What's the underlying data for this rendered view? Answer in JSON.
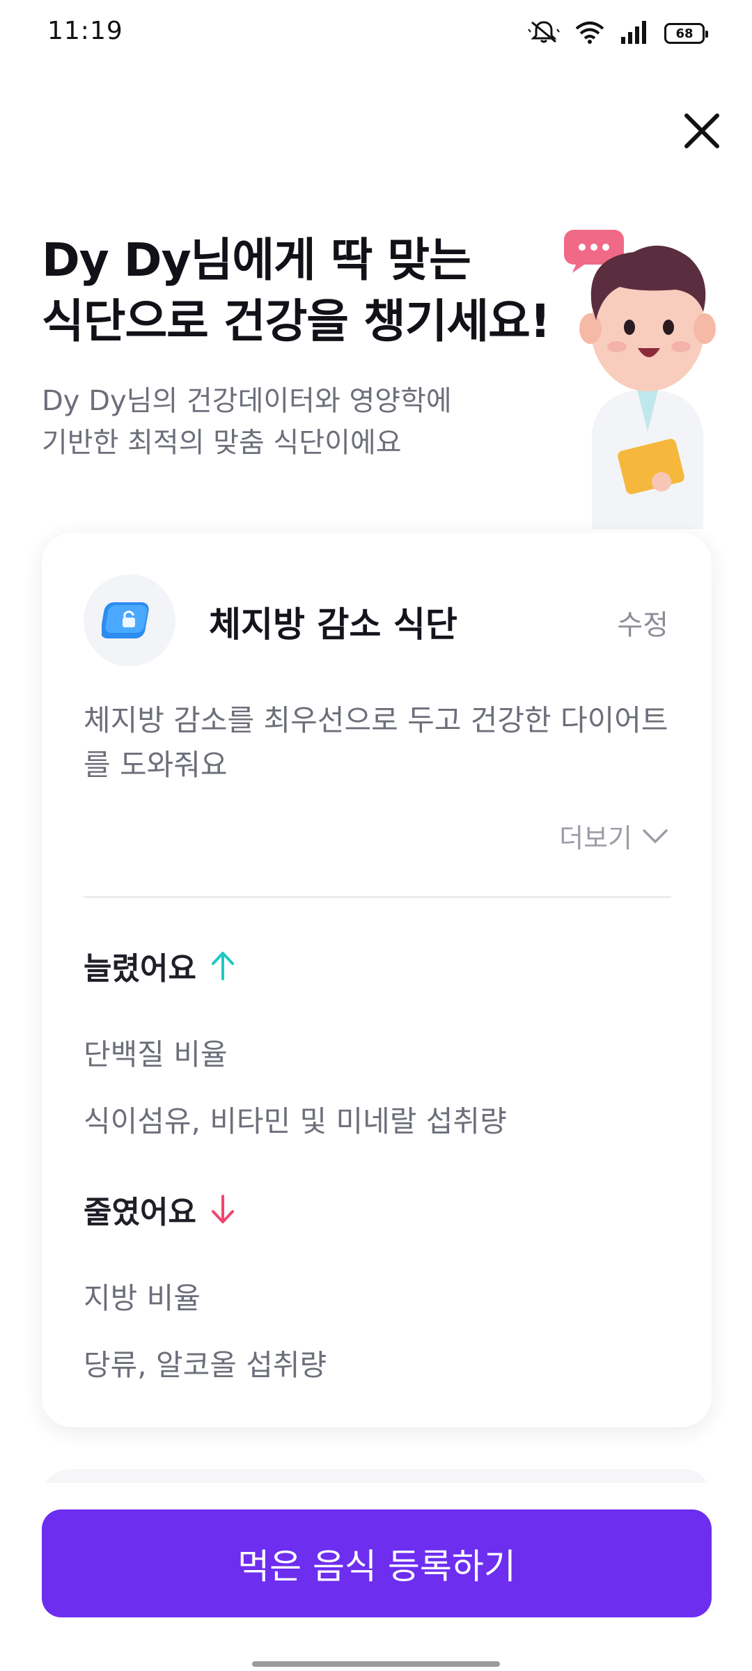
{
  "status_bar": {
    "time": "11:19",
    "battery": "68",
    "icons": [
      "mute-icon",
      "wifi-icon",
      "signal-icon",
      "battery-icon"
    ]
  },
  "header": {
    "headline_line1": "Dy Dy님에게 딱 맞는",
    "headline_line2": "식단으로 건강을 챙기세요!",
    "subtitle_line1": "Dy Dy님의 건강데이터와 영양학에",
    "subtitle_line2": "기반한 최적의 맞춤 식단이에요"
  },
  "plan": {
    "title": "체지방 감소 식단",
    "edit_label": "수정",
    "description": "체지방 감소를 최우선으로 두고 건강한 다이어트를 도와줘요",
    "more_label": "더보기",
    "increased": {
      "heading": "늘렸어요",
      "items": [
        "단백질 비율",
        "식이섬유, 비타민 및 미네랄 섭취량"
      ]
    },
    "decreased": {
      "heading": "줄였어요",
      "items": [
        "지방 비율",
        "당류, 알코올 섭취량"
      ]
    }
  },
  "cta": {
    "label": "먹은 음식 등록하기"
  },
  "colors": {
    "accent": "#6d2ef0",
    "increase_arrow": "#1ec8c4",
    "decrease_arrow": "#f0466e"
  }
}
